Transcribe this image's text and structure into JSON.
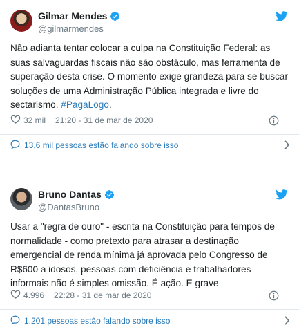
{
  "tweets": [
    {
      "name": "Gilmar Mendes",
      "handle": "@gilmarmendes",
      "text": "Não adianta tentar colocar a culpa na Constituição Federal: as suas salvaguardas fiscais não são obstáculo, mas ferramenta de superação desta crise. O momento exige grandeza para se buscar soluções de uma Administração Pública integrada e livre do sectarismo. ",
      "hashtag": "#PagaLogo",
      "hashtag_suffix": ".",
      "likes": "32 mil",
      "timestamp": "21:20 - 31 de mar de 2020",
      "conversation": "13,6 mil pessoas estão falando sobre isso"
    },
    {
      "name": "Bruno Dantas",
      "handle": "@DantasBruno",
      "text": "Usar a \"regra de ouro\" - escrita na Constituição para tempos de normalidade - como pretexto para atrasar a destinação emergencial de renda mínima já aprovada pelo Congresso de R$600 a idosos, pessoas com deficiência e trabalhadores informais não é simples omissão. É ação. E grave",
      "likes": "4.996",
      "timestamp": "22:28 - 31 de mar de 2020",
      "conversation": "1.201 pessoas estão falando sobre isso"
    }
  ],
  "icons": {
    "verified": "verified-badge-icon",
    "bird": "twitter-bird-icon",
    "heart": "heart-icon",
    "info": "info-icon",
    "bubble": "speech-bubble-icon",
    "chevron": "chevron-right-icon"
  },
  "colors": {
    "link": "#2b7bb9",
    "muted": "#697882",
    "verified": "#1da1f2",
    "bird": "#1da1f2"
  }
}
